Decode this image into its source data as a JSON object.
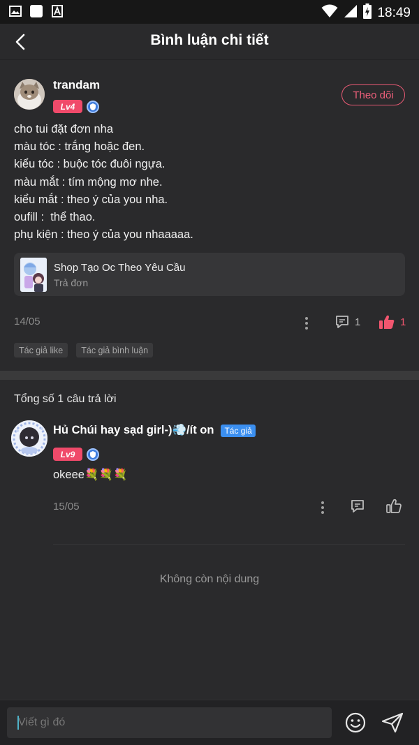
{
  "status_bar": {
    "time": "18:49",
    "left_icons": [
      "image-icon",
      "square-icon",
      "font-icon"
    ],
    "right_icons": [
      "wifi-icon",
      "signal-icon",
      "battery-charging-icon"
    ]
  },
  "header": {
    "title": "Bình luận chi tiết",
    "back_icon": "chevron-left-icon"
  },
  "post": {
    "author": "trandam",
    "level": "Lv4",
    "follow_label": "Theo dõi",
    "lines": [
      "cho tui đặt đơn nha",
      "màu tóc : trắng hoặc đen.",
      "kiểu tóc : buộc tóc đuôi ngựa.",
      "màu mắt : tím mộng mơ nhe.",
      "kiểu mắt : theo ý của you nha.",
      "oufill :  thể thao.",
      "phụ kiện : theo ý của you nhaaaaa."
    ],
    "shop_name": "Shop Tạo Oc Theo Yêu Cầu",
    "shop_sub": "Trả đơn",
    "date": "14/05",
    "comment_count": "1",
    "like_count": "1",
    "tags": [
      "Tác giả like",
      "Tác giả bình luận"
    ]
  },
  "replies": {
    "count_label": "Tổng số 1 câu trả lời",
    "items": [
      {
        "author": "Hủ Chúi hay sạd girl-)💨/ít on",
        "author_tag": "Tác giả",
        "level": "Lv9",
        "text": "okeee💐💐💐",
        "date": "15/05"
      }
    ],
    "end_label": "Không còn nội dung"
  },
  "composer": {
    "placeholder": "Viết gì đó"
  },
  "colors": {
    "background": "#2a2a2c",
    "accent_pink": "#f04a6a",
    "like_pink": "#f2566f",
    "author_blue": "#3b8ff0"
  }
}
